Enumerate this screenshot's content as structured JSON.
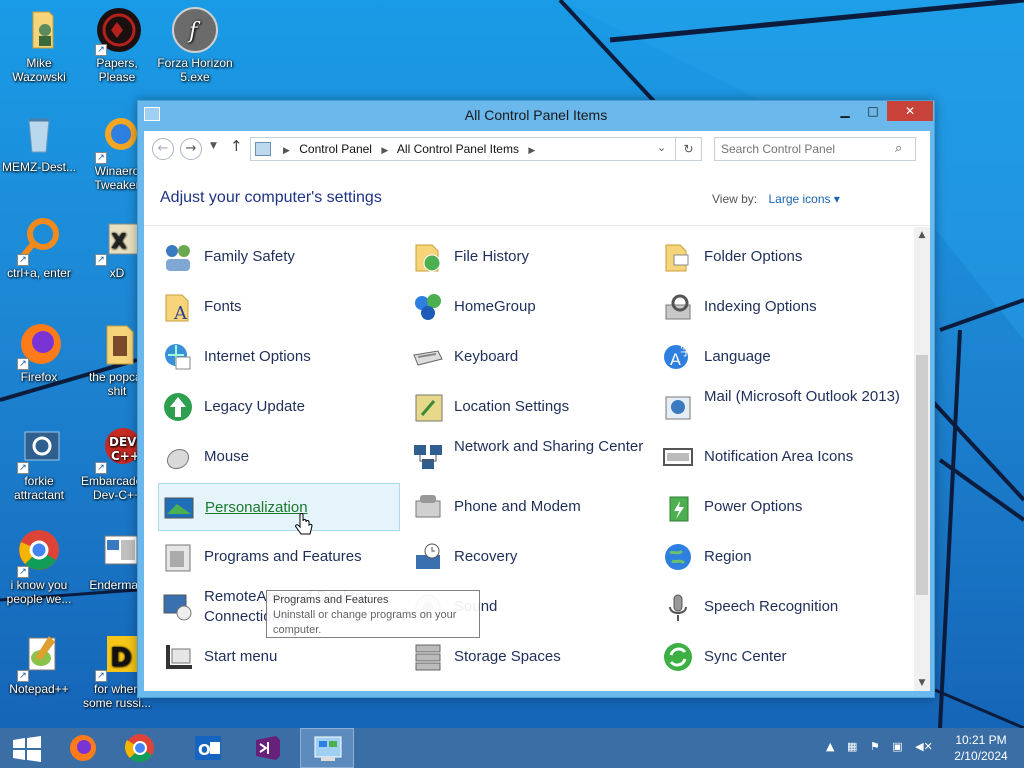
{
  "desktop": {
    "icons": [
      {
        "label": "Mike Wazowski"
      },
      {
        "label": "Papers, Please"
      },
      {
        "label": "Forza Horizon 5.exe"
      },
      {
        "label": "MEMZ-Dest..."
      },
      {
        "label": "Winaero Tweaker"
      },
      {
        "label": "ctrl+a, enter"
      },
      {
        "label": "xD"
      },
      {
        "label": "Firefox"
      },
      {
        "label": "the popcat shit"
      },
      {
        "label": "forkie attractant"
      },
      {
        "label": "Embarcadero Dev-C++"
      },
      {
        "label": "i know you people we..."
      },
      {
        "label": "Enderman"
      },
      {
        "label": "Notepad++"
      },
      {
        "label": "for when some russi..."
      }
    ]
  },
  "window": {
    "title": "All Control Panel Items",
    "minimize": "▁",
    "maximize": "□",
    "close": "✕",
    "breadcrumb": [
      "Control Panel",
      "All Control Panel Items"
    ],
    "search_placeholder": "Search Control Panel",
    "heading": "Adjust your computer's settings",
    "view_by_label": "View by:",
    "view_by_value": "Large icons",
    "items": [
      {
        "label": "Family Safety",
        "icon": "family-safety-icon"
      },
      {
        "label": "File History",
        "icon": "file-history-icon"
      },
      {
        "label": "Folder Options",
        "icon": "folder-options-icon"
      },
      {
        "label": "Fonts",
        "icon": "fonts-icon"
      },
      {
        "label": "HomeGroup",
        "icon": "homegroup-icon"
      },
      {
        "label": "Indexing Options",
        "icon": "indexing-options-icon"
      },
      {
        "label": "Internet Options",
        "icon": "internet-options-icon"
      },
      {
        "label": "Keyboard",
        "icon": "keyboard-icon"
      },
      {
        "label": "Language",
        "icon": "language-icon"
      },
      {
        "label": "Legacy Update",
        "icon": "legacy-update-icon"
      },
      {
        "label": "Location Settings",
        "icon": "location-settings-icon"
      },
      {
        "label": "Mail (Microsoft Outlook 2013)",
        "icon": "mail-icon"
      },
      {
        "label": "Mouse",
        "icon": "mouse-icon"
      },
      {
        "label": "Network and Sharing Center",
        "icon": "network-icon"
      },
      {
        "label": "Notification Area Icons",
        "icon": "notification-area-icon"
      },
      {
        "label": "Personalization",
        "icon": "personalization-icon"
      },
      {
        "label": "Phone and Modem",
        "icon": "phone-modem-icon"
      },
      {
        "label": "Power Options",
        "icon": "power-options-icon"
      },
      {
        "label": "Programs and Features",
        "icon": "programs-features-icon"
      },
      {
        "label": "Recovery",
        "icon": "recovery-icon"
      },
      {
        "label": "Region",
        "icon": "region-icon"
      },
      {
        "label": "RemoteApp and Desktop Connections",
        "icon": "remoteapp-icon"
      },
      {
        "label": "Sound",
        "icon": "sound-icon"
      },
      {
        "label": "Speech Recognition",
        "icon": "speech-recognition-icon"
      },
      {
        "label": "Start menu",
        "icon": "start-menu-icon"
      },
      {
        "label": "Storage Spaces",
        "icon": "storage-spaces-icon"
      },
      {
        "label": "Sync Center",
        "icon": "sync-center-icon"
      }
    ],
    "tooltip": {
      "title": "Programs and Features",
      "body": "Uninstall or change programs on your computer."
    }
  },
  "taskbar": {
    "clock_time": "10:21 PM",
    "clock_date": "2/10/2024",
    "tray_chevron": "▲"
  },
  "colors": {
    "accent": "#1e3287",
    "link": "#1a64b4",
    "title_bar": "#6ab8ec",
    "close_button": "#c9423a",
    "taskbar": "#3b6ea5"
  }
}
